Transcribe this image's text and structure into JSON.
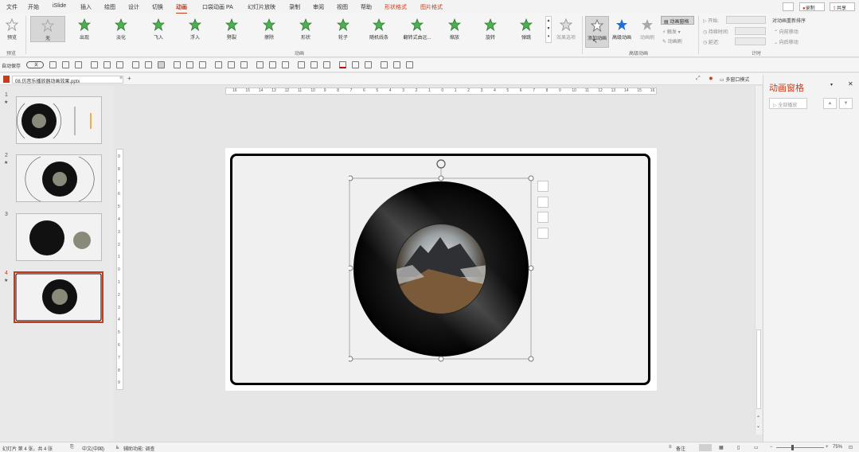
{
  "menu": {
    "items": [
      "文件",
      "开始",
      "iSlide",
      "插入",
      "绘图",
      "设计",
      "切换",
      "动画",
      "口袋动画 PA",
      "幻灯片放映",
      "录制",
      "审阅",
      "视图",
      "帮助",
      "形状格式",
      "图片格式"
    ],
    "active_index": 7,
    "right": {
      "comment_icon": "comment-icon",
      "record": "录制",
      "share": "共享"
    }
  },
  "ribbon": {
    "preview": "预览",
    "gallery": [
      "无",
      "出现",
      "淡化",
      "飞入",
      "浮入",
      "劈裂",
      "擦除",
      "形状",
      "轮子",
      "随机线条",
      "翻转式由远...",
      "缩放",
      "旋转",
      "弹跳"
    ],
    "effect_options": "效果选项",
    "add_animation": "添加动画",
    "anim_painter": "动画刷",
    "anim_pane_btn": "动画窗格",
    "trigger": "触发",
    "advanced_anim": "高级动画",
    "start_label": "开始:",
    "duration_label": "持续时间:",
    "delay_label": "延迟:",
    "reorder_title": "对动画重新排序",
    "move_earlier": "向前移动",
    "move_later": "向后移动",
    "groups": {
      "preview": "预览",
      "animation": "动画",
      "advanced": "高级动画",
      "timing": "计时"
    },
    "colors": {
      "star_green": "#4caf50",
      "star_gray": "#9e9e9e",
      "star_blue": "#1e6fd9"
    }
  },
  "qat": {
    "autosave": "自动保存",
    "autosave_state": "关"
  },
  "tab": {
    "filename": "08.仿音乐播放器动画效果.pptx",
    "close": "×",
    "add": "+",
    "multiwin": "多窗口模式"
  },
  "ruler": {
    "h_ticks": [
      "16",
      "15",
      "14",
      "13",
      "12",
      "11",
      "10",
      "9",
      "8",
      "7",
      "6",
      "5",
      "4",
      "3",
      "2",
      "1",
      "0",
      "1",
      "2",
      "3",
      "4",
      "5",
      "6",
      "7",
      "8",
      "9",
      "10",
      "11",
      "12",
      "13",
      "14",
      "15",
      "16"
    ],
    "v_ticks": [
      "9",
      "8",
      "7",
      "6",
      "5",
      "4",
      "3",
      "2",
      "1",
      "0",
      "1",
      "2",
      "3",
      "4",
      "5",
      "6",
      "7",
      "8",
      "9"
    ]
  },
  "thumbnails": [
    {
      "num": "1",
      "star": "★"
    },
    {
      "num": "2",
      "star": "★"
    },
    {
      "num": "3",
      "star": ""
    },
    {
      "num": "4",
      "star": "★"
    }
  ],
  "pane": {
    "title": "动画窗格",
    "play_all": "全部播放",
    "up": "▲",
    "down": "▼"
  },
  "status": {
    "slide_info": "幻灯片 第 4 张，共 4 张",
    "language": "中文(中国)",
    "accessibility": "辅助功能: 调查",
    "notes": "备注",
    "zoom": "75%"
  }
}
